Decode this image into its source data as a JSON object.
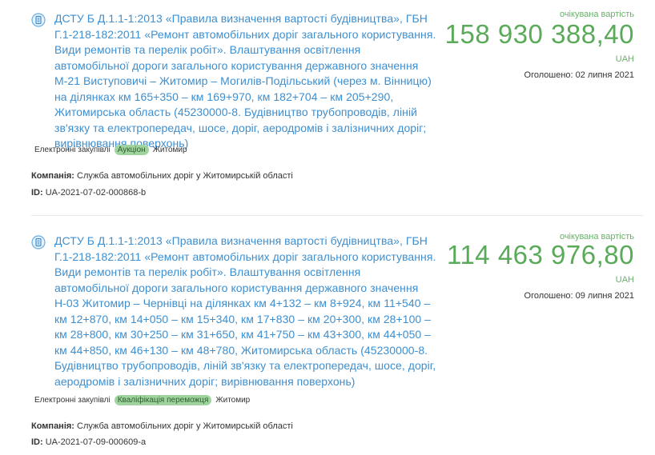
{
  "tenders": [
    {
      "title": "ДСТУ Б Д.1.1-1:2013 «Правила визначення вартості будівництва», ГБН Г.1-218-182:2011 «Ремонт автомобільних доріг загального користування. Види ремонтів та перелік робіт». Влаштування освітлення автомобільної дороги загального користування державного значення М-21 Виступовичі – Житомир – Могилів-Подільський (через м. Вінницю) на ділянках км 165+350 – км 169+970, км 182+704 – км 205+290, Житомирська область (45230000-8. Будівництво трубопроводів, ліній зв'язку та електропередач, шосе, доріг, аеродромів і залізничних доріг; вирівнювання поверхонь)",
      "price_label": "очікувана вартість",
      "price": "158 930 388,40",
      "currency": "UAH",
      "announced": "Оголошено: 02 липня 2021",
      "tag_type": "Електронні закупівлі",
      "tag_status": "Аукціон",
      "tag_region": "Житомир",
      "company_label": "Компанія:",
      "company": "Служба автомобільних доріг у Житомирській області",
      "id_label": "ID:",
      "id": "UA-2021-07-02-000868-b"
    },
    {
      "title": "ДСТУ Б Д.1.1-1:2013 «Правила визначення вартості будівництва», ГБН Г.1-218-182:2011 «Ремонт автомобільних доріг загального користування. Види ремонтів та перелік робіт». Влаштування освітлення автомобільної дороги загального користування державного значення Н-03 Житомир – Чернівці на ділянках км 4+132 – км 8+924, км 11+540 – км 12+870, км 14+050 – км 15+340, км 17+830 – км 20+300, км 28+100 – км 28+800, км 30+250 – км 31+650, км 41+750 – км 43+300, км 44+050 – км 44+850, км 46+130 – км 48+780, Житомирська область (45230000-8. Будівництво трубопроводів, ліній зв'язку та електропередач, шосе, доріг, аеродромів і залізничних доріг; вирівнювання поверхонь)",
      "price_label": "очікувана вартість",
      "price": "114 463 976,80",
      "currency": "UAH",
      "announced": "Оголошено: 09 липня 2021",
      "tag_type": "Електронні закупівлі",
      "tag_status": "Кваліфікація переможця",
      "tag_region": "Житомир",
      "company_label": "Компанія:",
      "company": "Служба автомобільних доріг у Житомирській області",
      "id_label": "ID:",
      "id": "UA-2021-07-09-000609-a"
    }
  ]
}
